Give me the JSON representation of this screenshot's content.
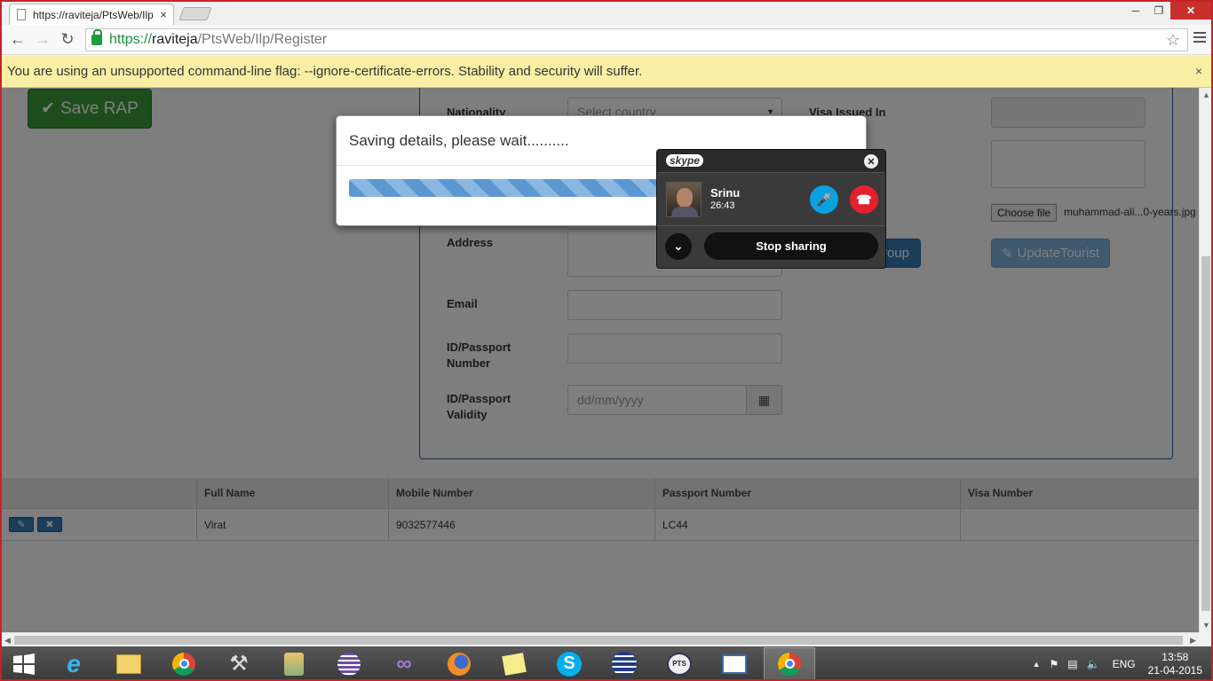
{
  "browser": {
    "tab_title": "https://raviteja/PtsWeb/Ilp",
    "tab_close": "×",
    "url_scheme": "https://",
    "url_host": "raviteja",
    "url_path": "/PtsWeb/Ilp/Register",
    "infobar_text": "You are using an unsupported command-line flag: --ignore-certificate-errors. Stability and security will suffer.",
    "infobar_close": "×"
  },
  "page": {
    "save_button": "Save RAP",
    "form": {
      "nationality_label": "Nationality",
      "nationality_placeholder": "Select country",
      "visa_issued_label": "Visa Issued In",
      "address_label": "Address",
      "email_label": "Email",
      "passport_number_label": "ID/Passport Number",
      "passport_validity_label": "ID/Passport Validity",
      "date_placeholder": "dd/mm/yyyy",
      "choose_file_label": "Choose file",
      "file_name": "muhammad-ali...0-years.jpg",
      "group_button": "roup",
      "update_tourist_button": "UpdateTourist"
    },
    "table": {
      "headers": [
        "",
        "Full Name",
        "Mobile Number",
        "Passport Number",
        "Visa Number"
      ],
      "rows": [
        {
          "full_name": "Virat",
          "mobile": "9032577446",
          "passport": "LC44",
          "visa": ""
        }
      ]
    }
  },
  "modal": {
    "title": "Saving details, please wait..........",
    "progress": 1.0
  },
  "skype": {
    "logo": "skype",
    "caller_name": "Srinu",
    "call_time": "26:43",
    "stop_sharing": "Stop sharing"
  },
  "taskbar": {
    "language": "ENG",
    "time": "13:58",
    "date": "21-04-2015"
  }
}
